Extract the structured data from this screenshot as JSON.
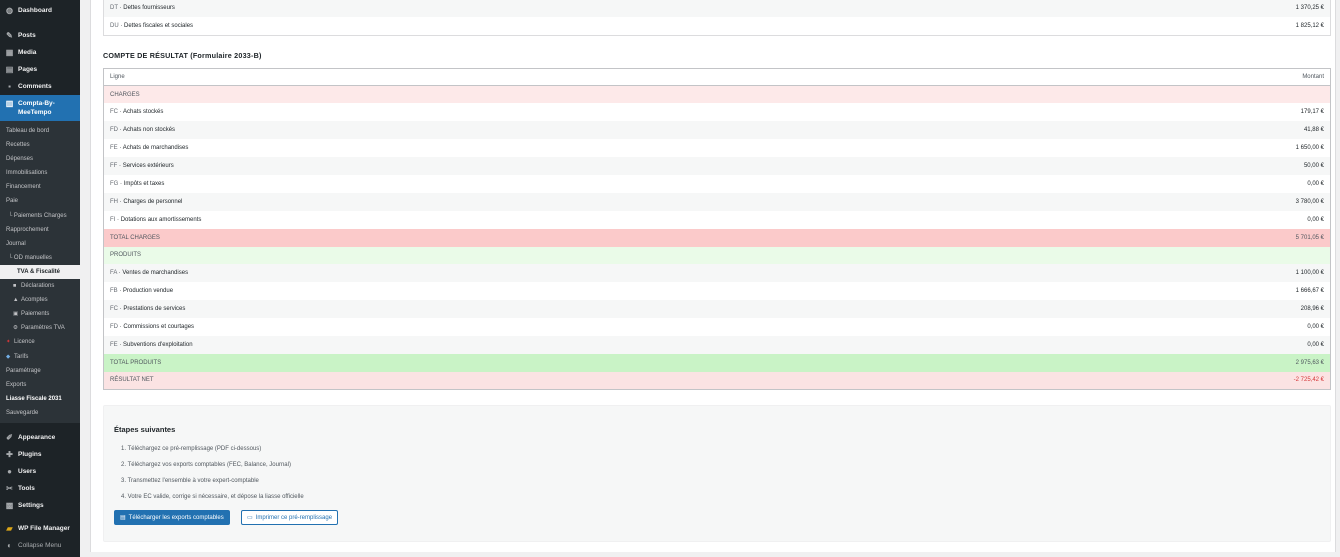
{
  "sidebar": {
    "top": [
      {
        "label": "Dashboard",
        "icon": "dashboard-icon"
      },
      {
        "label": "Posts",
        "icon": "pin-icon"
      },
      {
        "label": "Media",
        "icon": "media-icon"
      },
      {
        "label": "Pages",
        "icon": "pages-icon"
      },
      {
        "label": "Comments",
        "icon": "comments-icon"
      }
    ],
    "current": {
      "label1": "Compta-By-",
      "label2": "MeeTempo",
      "icon": "calculator-icon"
    },
    "sub": [
      "Tableau de bord",
      "Recettes",
      "Dépenses",
      "Immobilisations",
      "Financement",
      "Paie",
      "└ Paiements Charges",
      "Rapprochement",
      "Journal",
      "└ OD manuelles",
      "TVA & Fiscalité",
      "Déclarations",
      "Acomptes",
      "Paiements",
      "Paramètres TVA",
      "Licence",
      "Tarifs",
      "Paramétrage",
      "Exports",
      "Liasse Fiscale 2031",
      "Sauvegarde"
    ],
    "bottom": [
      {
        "label": "Appearance",
        "icon": "brush-icon"
      },
      {
        "label": "Plugins",
        "icon": "plugin-icon"
      },
      {
        "label": "Users",
        "icon": "users-icon"
      },
      {
        "label": "Tools",
        "icon": "wrench-icon"
      },
      {
        "label": "Settings",
        "icon": "settings-icon"
      },
      {
        "label": "WP File Manager",
        "icon": "folder-icon"
      },
      {
        "label": "Collapse Menu",
        "icon": "collapse-icon"
      }
    ]
  },
  "bilan_tail": [
    {
      "code": "DT",
      "label": "Dettes fournisseurs",
      "amount": "1 370,25 €"
    },
    {
      "code": "DU",
      "label": "Dettes fiscales et sociales",
      "amount": "1 825,12 €"
    }
  ],
  "compte_resultat": {
    "title": "COMPTE DE RÉSULTAT (Formulaire 2033-B)",
    "col_ligne": "Ligne",
    "col_montant": "Montant",
    "charges_header": "CHARGES",
    "charges": [
      {
        "code": "FC",
        "label": "Achats stockés",
        "amount": "179,17 €"
      },
      {
        "code": "FD",
        "label": "Achats non stockés",
        "amount": "41,88 €"
      },
      {
        "code": "FE",
        "label": "Achats de marchandises",
        "amount": "1 650,00 €"
      },
      {
        "code": "FF",
        "label": "Services extérieurs",
        "amount": "50,00 €"
      },
      {
        "code": "FG",
        "label": "Impôts et taxes",
        "amount": "0,00 €"
      },
      {
        "code": "FH",
        "label": "Charges de personnel",
        "amount": "3 780,00 €"
      },
      {
        "code": "FI",
        "label": "Dotations aux amortissements",
        "amount": "0,00 €"
      }
    ],
    "total_charges_label": "TOTAL CHARGES",
    "total_charges": "5 701,05 €",
    "produits_header": "PRODUITS",
    "produits": [
      {
        "code": "FA",
        "label": "Ventes de marchandises",
        "amount": "1 100,00 €"
      },
      {
        "code": "FB",
        "label": "Production vendue",
        "amount": "1 666,67 €"
      },
      {
        "code": "FC",
        "label": "Prestations de services",
        "amount": "208,96 €"
      },
      {
        "code": "FD",
        "label": "Commissions et courtages",
        "amount": "0,00 €"
      },
      {
        "code": "FE",
        "label": "Subventions d'exploitation",
        "amount": "0,00 €"
      }
    ],
    "total_produits_label": "TOTAL PRODUITS",
    "total_produits": "2 975,63 €",
    "resultat_label": "RÉSULTAT NET",
    "resultat": "-2 725,42 €"
  },
  "steps": {
    "title": "Étapes suivantes",
    "items": [
      "1. Téléchargez ce pré-remplissage (PDF ci-dessous)",
      "2. Téléchargez vos exports comptables (FEC, Balance, Journal)",
      "3. Transmettez l'ensemble à votre expert-comptable",
      "4. Votre EC valide, corrige si nécessaire, et dépose la liasse officielle"
    ],
    "btn_exports": "Télécharger les exports comptables",
    "btn_print": "Imprimer ce pré-remplissage"
  }
}
